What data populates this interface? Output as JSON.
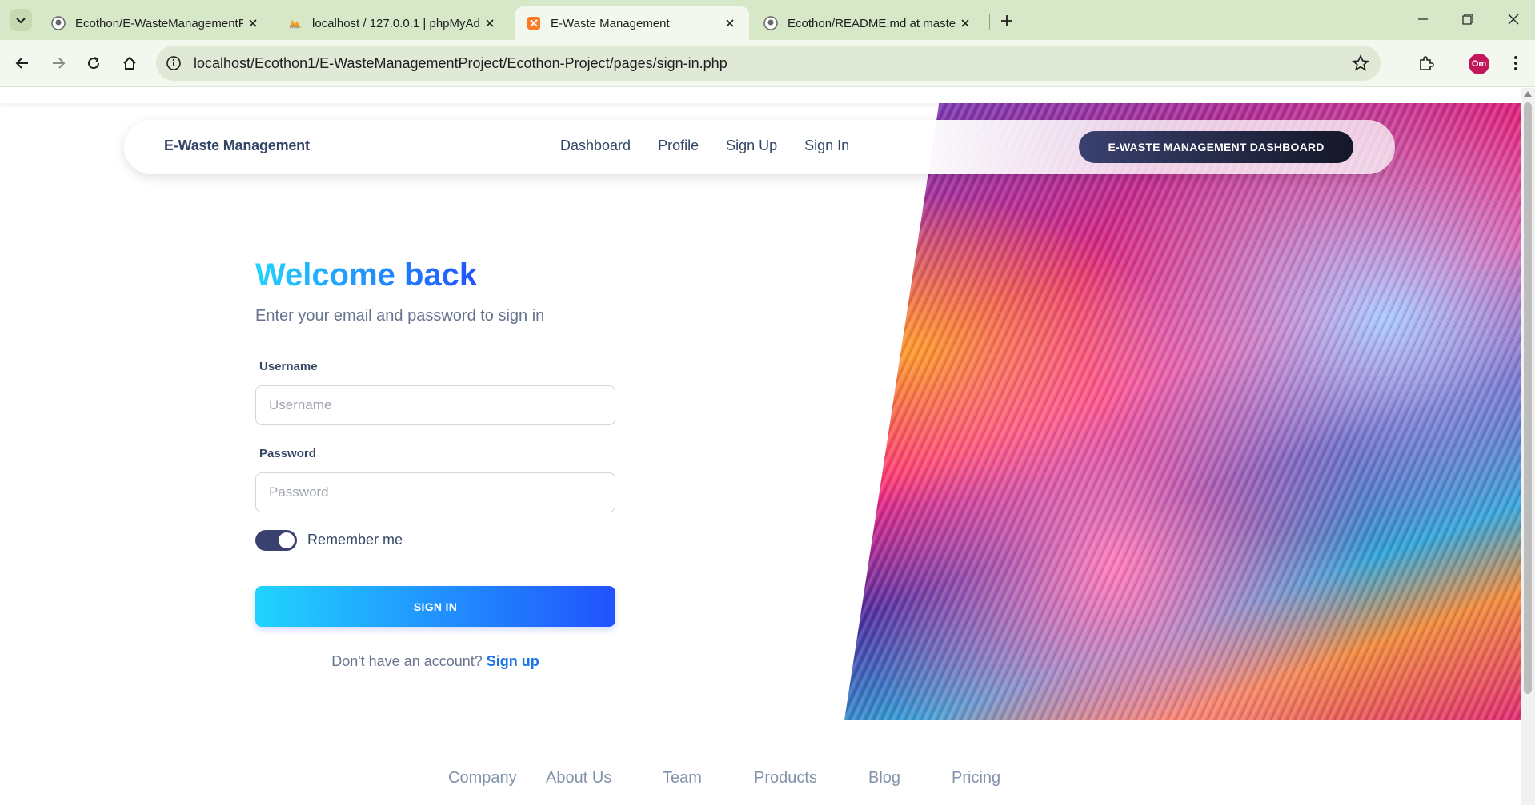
{
  "browser": {
    "tabs": [
      {
        "title": "Ecothon/E-WasteManagementP",
        "icon": "github-icon"
      },
      {
        "title": "localhost / 127.0.0.1 | phpMyAd",
        "icon": "phpmyadmin-icon"
      },
      {
        "title": "E-Waste Management",
        "icon": "xampp-icon",
        "active": true
      },
      {
        "title": "Ecothon/README.md at master",
        "icon": "github-icon"
      }
    ],
    "url": "localhost/Ecothon1/E-WasteManagementProject/Ecothon-Project/pages/sign-in.php",
    "profile_initials": "Om"
  },
  "navbar": {
    "brand": "E-Waste Management",
    "links": [
      "Dashboard",
      "Profile",
      "Sign Up",
      "Sign In"
    ],
    "cta": "E-WASTE MANAGEMENT DASHBOARD"
  },
  "signin": {
    "title": "Welcome back",
    "subtitle": "Enter your email and password to sign in",
    "username_label": "Username",
    "username_placeholder": "Username",
    "password_label": "Password",
    "password_placeholder": "Password",
    "remember_label": "Remember me",
    "remember_checked": true,
    "submit": "SIGN IN",
    "no_account": "Don't have an account?",
    "signup_link": "Sign up"
  },
  "footer": {
    "links": [
      "Company",
      "About Us",
      "Team",
      "Products",
      "Blog",
      "Pricing"
    ]
  },
  "colors": {
    "primary_gradient_start": "#21d4fd",
    "primary_gradient_end": "#2152ff",
    "dark": "#344767",
    "browser_tabstrip": "#d7e8c8"
  }
}
